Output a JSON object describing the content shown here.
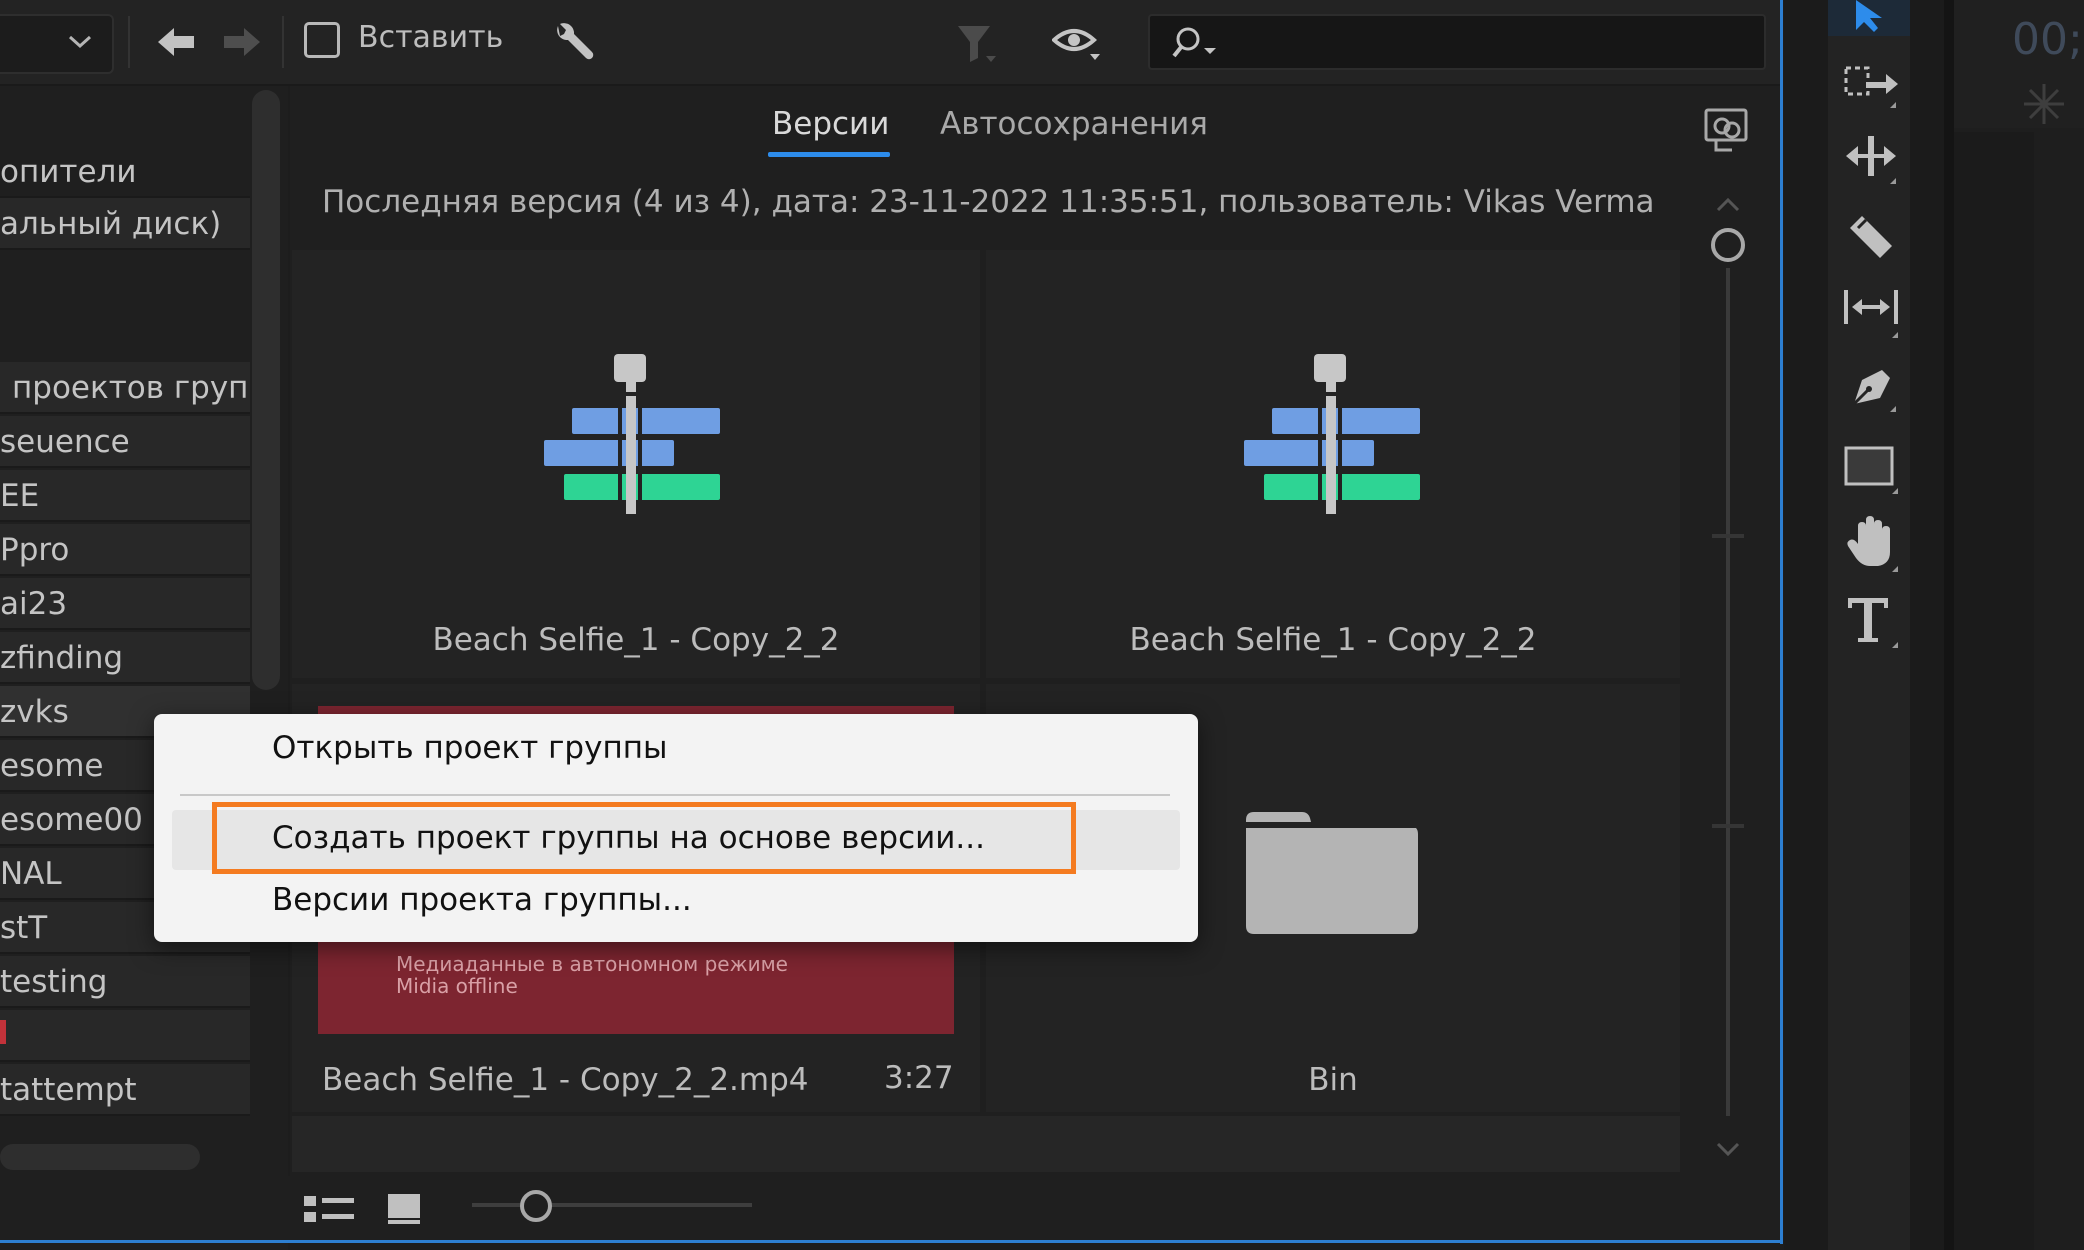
{
  "toolbar": {
    "insert_label": "Вставить",
    "search_placeholder": ""
  },
  "left_panel": {
    "items": [
      {
        "label": "опители",
        "style": "plain"
      },
      {
        "label": "альный диск)",
        "style": "list"
      },
      {
        "label": "проектов групп",
        "style": "list"
      },
      {
        "label": "seuence",
        "style": "list"
      },
      {
        "label": "EE",
        "style": "list"
      },
      {
        "label": "Ppro",
        "style": "list"
      },
      {
        "label": "ai23",
        "style": "list"
      },
      {
        "label": "zfinding",
        "style": "list"
      },
      {
        "label": "zvks",
        "style": "selected"
      },
      {
        "label": "esome",
        "style": "list"
      },
      {
        "label": "esome00",
        "style": "list"
      },
      {
        "label": "NAL",
        "style": "list"
      },
      {
        "label": "stT",
        "style": "list"
      },
      {
        "label": "testing",
        "style": "list"
      },
      {
        "label": "",
        "style": "list"
      },
      {
        "label": "tattempt",
        "style": "list"
      }
    ]
  },
  "tabs": {
    "versions": "Версии",
    "autosaves": "Автосохранения",
    "active": "versions"
  },
  "version_info": "Последняя версия (4 из 4), дата: 23-11-2022 11:35:51, пользователь: Vikas Verma",
  "grid": {
    "items": [
      {
        "label": "Beach Selfie_1 - Copy_2_2",
        "type": "sequence-icon"
      },
      {
        "label": "Beach Selfie_1 - Copy_2_2",
        "type": "sequence-icon"
      },
      {
        "label": "Beach Selfie_1 - Copy_2_2.mp4",
        "duration": "3:27",
        "type": "offline-media",
        "offline_text_1": "Медиаданные в автономном режиме",
        "offline_text_2": "Midia offline"
      },
      {
        "label": "Bin",
        "type": "folder-icon"
      }
    ]
  },
  "context_menu": {
    "items": [
      {
        "label": "Открыть проект группы"
      },
      {
        "label": "Создать проект группы на основе версии...",
        "highlighted": true
      },
      {
        "label": "Версии проекта группы..."
      }
    ],
    "highlight_color": "#f47b20"
  },
  "right_panel": {
    "timecode": "00;"
  },
  "tools": [
    "selection-tool",
    "track-select-tool",
    "ripple-edit-tool",
    "razor-tool",
    "slip-tool",
    "pen-tool",
    "rectangle-tool",
    "hand-tool",
    "type-tool"
  ],
  "colors": {
    "accent_blue": "#2d8ceb",
    "sequence_blue": "#6f9ee3",
    "sequence_green": "#2ed494",
    "offline_red": "#7d2530"
  }
}
